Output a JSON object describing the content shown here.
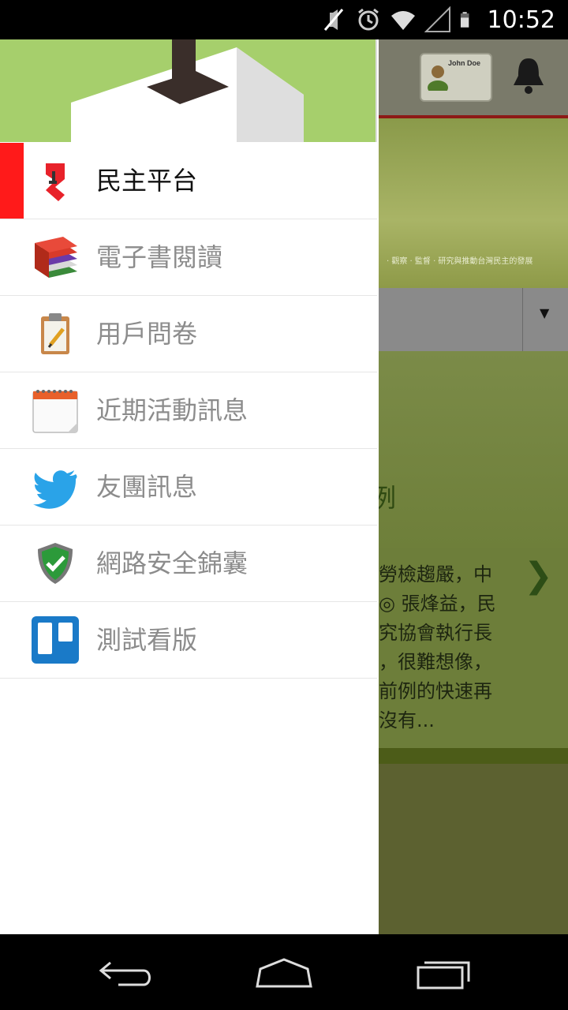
{
  "status_bar": {
    "time": "10:52",
    "icons": [
      "mute-icon",
      "alarm-icon",
      "wifi-icon",
      "signal-icon",
      "battery-icon"
    ]
  },
  "background_app": {
    "profile_card_name": "John Doe",
    "banner_text": "‧ 觀察 ‧ 監督 ‧ 研究與推動台灣民主的發展",
    "article_lines": [
      "勞檢趨嚴，中",
      "◎ 張烽益，民",
      "究協會執行長",
      "，很難想像，",
      "前例的快速再",
      "沒有..."
    ],
    "partial_heading_glyph": "例",
    "next_symbol": "❯",
    "select_arrow": "▼"
  },
  "drawer": {
    "menu": [
      {
        "label": "民主平台",
        "icon": "democracy-logo-icon",
        "active": true
      },
      {
        "label": "電子書閱讀",
        "icon": "books-icon",
        "active": false
      },
      {
        "label": "用戶問卷",
        "icon": "clipboard-icon",
        "active": false
      },
      {
        "label": "近期活動訊息",
        "icon": "calendar-icon",
        "active": false
      },
      {
        "label": "友團訊息",
        "icon": "twitter-bird-icon",
        "active": false
      },
      {
        "label": "網路安全錦囊",
        "icon": "security-shield-icon",
        "active": false
      },
      {
        "label": "測試看版",
        "icon": "trello-board-icon",
        "active": false
      }
    ]
  },
  "colors": {
    "active_bar": "#ff1a1a",
    "drawer_header_green": "#a6cf6c",
    "active_label": "#111111",
    "inactive_label": "#8c8c8c"
  }
}
